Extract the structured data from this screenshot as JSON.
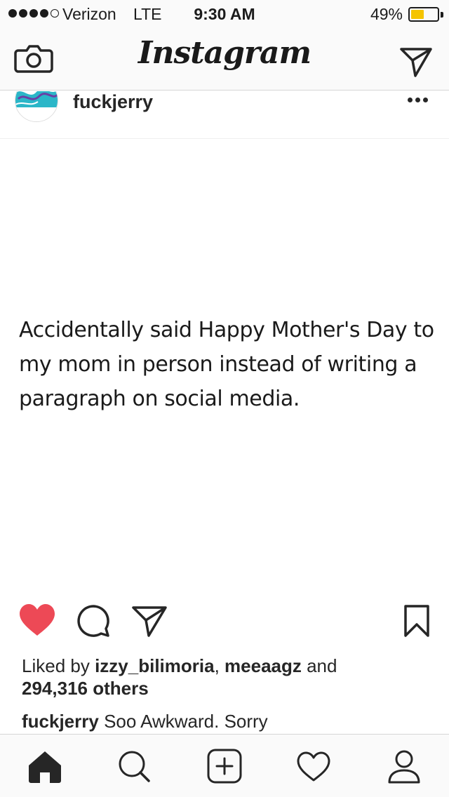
{
  "status_bar": {
    "carrier": "Verizon",
    "network": "LTE",
    "time": "9:30 AM",
    "battery_percent": "49%",
    "battery_level": 0.49,
    "battery_color": "#f5c400",
    "signal_bars_filled": 4,
    "signal_bars_total": 5
  },
  "header": {
    "logo": "Instagram",
    "left_icon": "camera-icon",
    "right_icon": "direct-message-icon"
  },
  "post": {
    "username": "fuckjerry",
    "image_text": "Accidentally said Happy Mother's Day to my mom in person instead of writing a paragraph on social media.",
    "liked": true,
    "like_color": "#ed4956",
    "likes": {
      "prefix": "Liked by ",
      "user1": "izzy_bilimoria",
      "separator": ", ",
      "user2": "meeaagz",
      "conjunction": " and",
      "count": "294,316 others"
    },
    "caption": {
      "username": "fuckjerry",
      "text": " Soo Awkward. Sorry"
    }
  },
  "tab_bar": {
    "items": [
      "home-icon",
      "search-icon",
      "add-post-icon",
      "activity-heart-icon",
      "profile-icon"
    ],
    "active": "home-icon"
  }
}
